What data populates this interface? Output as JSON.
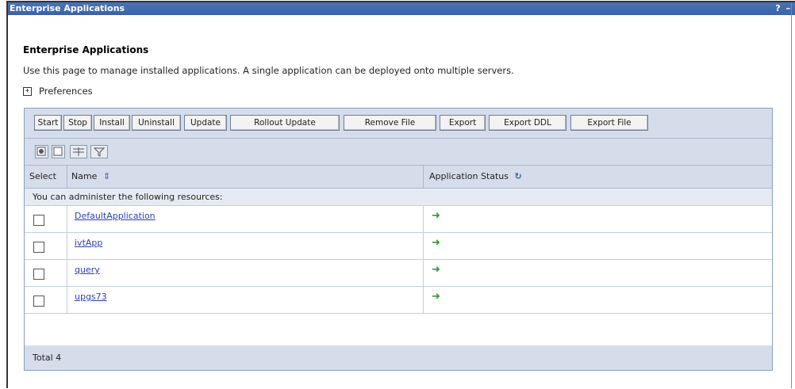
{
  "window": {
    "title": "Enterprise Applications",
    "help_icon": "?",
    "minimize_icon": "–"
  },
  "page": {
    "heading": "Enterprise Applications",
    "description": "Use this page to manage installed applications. A single application can be deployed onto multiple servers.",
    "preferences_label": "Preferences",
    "expand_icon": "+"
  },
  "toolbar": {
    "buttons": [
      "Start",
      "Stop",
      "Install",
      "Uninstall",
      "Update",
      "Rollout Update",
      "Remove File",
      "Export",
      "Export DDL",
      "Export File"
    ]
  },
  "icon_toolbar": {
    "icons": [
      "select-all-icon",
      "deselect-all-icon",
      "show-filter-icon",
      "clear-filter-icon"
    ]
  },
  "table": {
    "columns": [
      "Select",
      "Name",
      "Application Status"
    ],
    "sort_icon": "⇕",
    "refresh_icon": "↻",
    "admin_note": "You can administer the following resources:",
    "rows": [
      {
        "name": "DefaultApplication",
        "status_icon": "started-arrow-icon"
      },
      {
        "name": "ivtApp",
        "status_icon": "started-arrow-icon"
      },
      {
        "name": "query",
        "status_icon": "started-arrow-icon"
      },
      {
        "name": "upgs73",
        "status_icon": "started-arrow-icon"
      }
    ],
    "total": "Total 4"
  },
  "colors": {
    "titlebar": "#3a62a8",
    "panel_bg": "#d5ddea",
    "link": "#2f3fb0",
    "status_arrow": "#2e9a2e"
  }
}
